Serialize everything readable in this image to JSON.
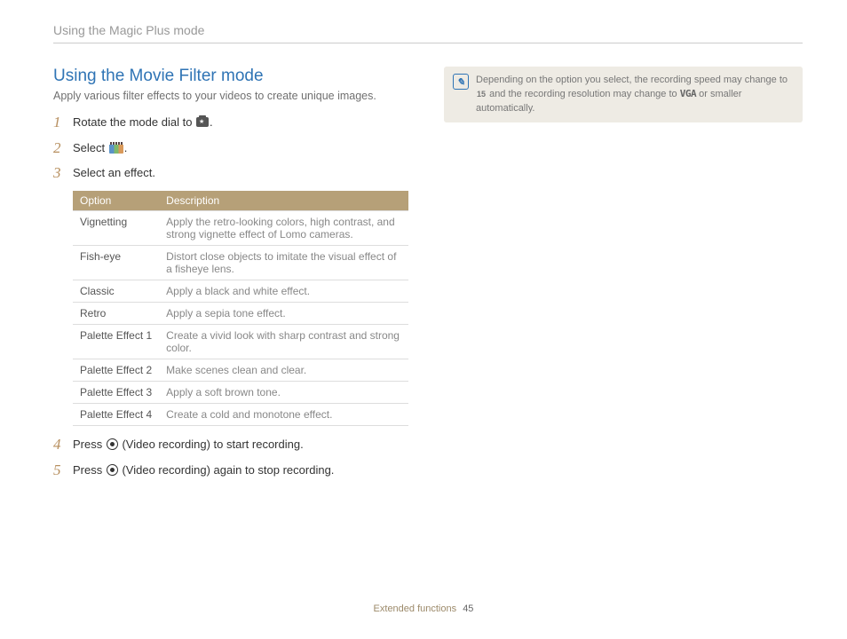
{
  "header": {
    "section": "Using the Magic Plus mode"
  },
  "main": {
    "title": "Using the Movie Filter mode",
    "subtitle": "Apply various filter effects to your videos to create unique images.",
    "steps": {
      "s1_pre": "Rotate the mode dial to ",
      "s1_post": ".",
      "s2_pre": "Select ",
      "s2_post": ".",
      "s3": "Select an effect.",
      "s4_pre": "Press ",
      "s4_post": " (Video recording) to start recording.",
      "s5_pre": "Press ",
      "s5_post": " (Video recording) again to stop recording."
    },
    "table": {
      "th_option": "Option",
      "th_desc": "Description",
      "rows": [
        {
          "opt": "Vignetting",
          "desc": "Apply the retro-looking colors, high contrast, and strong vignette effect of Lomo cameras."
        },
        {
          "opt": "Fish-eye",
          "desc": "Distort close objects to imitate the visual effect of a fisheye lens."
        },
        {
          "opt": "Classic",
          "desc": "Apply a black and white effect."
        },
        {
          "opt": "Retro",
          "desc": "Apply a sepia tone effect."
        },
        {
          "opt": "Palette Effect 1",
          "desc": "Create a vivid look with sharp contrast and strong color."
        },
        {
          "opt": "Palette Effect 2",
          "desc": "Make scenes clean and clear."
        },
        {
          "opt": "Palette Effect 3",
          "desc": "Apply a soft brown tone."
        },
        {
          "opt": "Palette Effect 4",
          "desc": "Create a cold and monotone effect."
        }
      ]
    }
  },
  "note": {
    "t1": "Depending on the option you select, the recording speed may change to ",
    "fps": "15",
    "t2": " and the recording resolution may change to ",
    "vga": "VGA",
    "t3": " or smaller automatically."
  },
  "footer": {
    "label": "Extended functions",
    "page": "45"
  }
}
